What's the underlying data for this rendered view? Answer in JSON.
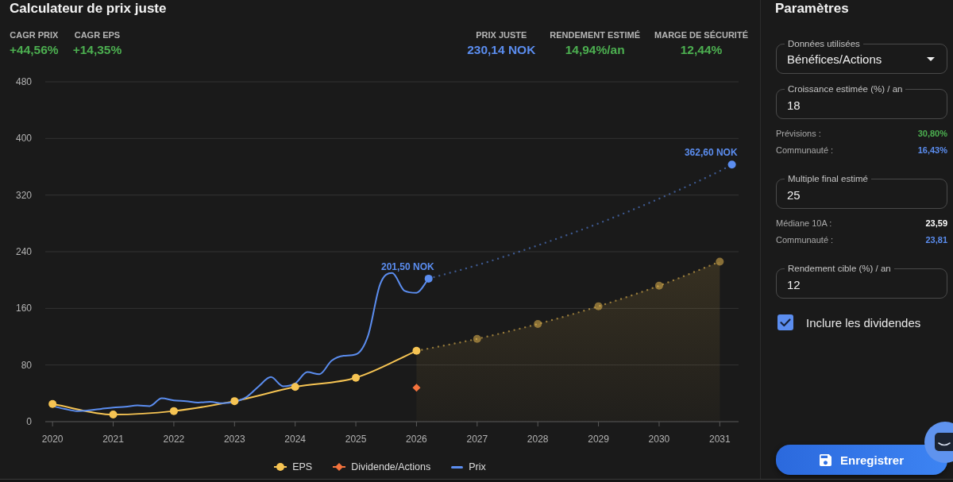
{
  "header": {
    "title": "Calculateur de prix juste"
  },
  "stats": {
    "left": [
      {
        "label": "CAGR PRIX",
        "value": "+44,56%",
        "color": "#4caf50"
      },
      {
        "label": "CAGR EPS",
        "value": "+14,35%",
        "color": "#4caf50"
      }
    ],
    "right": [
      {
        "label": "PRIX JUSTE",
        "value": "230,14 NOK",
        "color": "#5b8def"
      },
      {
        "label": "RENDEMENT ESTIMÉ",
        "value": "14,94%/an",
        "color": "#4caf50"
      },
      {
        "label": "MARGE DE SÉCURITÉ",
        "value": "12,44%",
        "color": "#4caf50"
      }
    ]
  },
  "chart": {
    "chart_data": {
      "type": "line",
      "grid": true,
      "x": [
        2020,
        2020.2,
        2020.4,
        2020.6,
        2020.8,
        2021,
        2021.2,
        2021.4,
        2021.6,
        2021.8,
        2022,
        2022.2,
        2022.4,
        2022.6,
        2022.8,
        2023,
        2023.2,
        2023.4,
        2023.6,
        2023.8,
        2024,
        2024.2,
        2024.4,
        2024.6,
        2024.8,
        2025,
        2025.2,
        2025.4,
        2025.6,
        2025.8,
        2026,
        2026.2,
        2027,
        2028,
        2029,
        2030,
        2031,
        2031.2
      ],
      "series": [
        {
          "name": "EPS",
          "color": "#f6c453",
          "marker": "circle",
          "values": [
            25,
            null,
            null,
            null,
            null,
            10,
            null,
            null,
            null,
            null,
            15,
            null,
            null,
            null,
            null,
            29,
            null,
            null,
            null,
            null,
            49,
            null,
            null,
            null,
            null,
            62,
            null,
            null,
            null,
            null,
            100,
            null,
            117,
            138,
            163,
            192,
            226,
            null
          ]
        },
        {
          "name": "Dividende/Actions",
          "color": "#f4733d",
          "marker": "diamond",
          "values": [
            null,
            null,
            null,
            null,
            null,
            null,
            null,
            null,
            null,
            null,
            null,
            null,
            null,
            null,
            null,
            null,
            null,
            null,
            null,
            null,
            null,
            null,
            null,
            null,
            null,
            null,
            null,
            null,
            null,
            null,
            48,
            null,
            null,
            null,
            null,
            null,
            null,
            null
          ]
        },
        {
          "name": "Prix",
          "color": "#5b8def",
          "values": [
            22,
            18,
            15,
            16,
            18,
            20,
            21,
            23,
            22,
            33,
            30,
            29,
            27,
            28,
            26,
            28,
            35,
            50,
            63,
            50,
            54,
            70,
            67,
            86,
            93,
            95,
            121,
            194,
            210,
            185,
            182,
            202,
            221,
            249,
            280,
            315,
            354,
            363
          ]
        }
      ],
      "xlim": [
        2019.88,
        2031.31
      ],
      "ylim": [
        0,
        480
      ],
      "xticks": [
        2020,
        2021,
        2022,
        2023,
        2024,
        2025,
        2026,
        2027,
        2028,
        2029,
        2030,
        2031
      ],
      "yticks": [
        0,
        80,
        160,
        240,
        320,
        400,
        480
      ],
      "annotations": [
        {
          "x": 2026.2,
          "y": 202,
          "text": "201,50 NOK"
        },
        {
          "x": 2031.2,
          "y": 363,
          "text": "362,60 NOK"
        }
      ]
    }
  },
  "sidebar": {
    "title": "Paramètres",
    "items": [
      {
        "kind": "select",
        "label": "Données utilisées",
        "value": "Bénéfices/Actions"
      },
      {
        "kind": "input",
        "label": "Croissance estimée (%) / an",
        "value": "18"
      },
      {
        "kind": "info",
        "label": "Prévisions :",
        "value": "30,80%",
        "color": "#4caf50"
      },
      {
        "kind": "info",
        "label": "Communauté :",
        "value": "16,43%",
        "color": "#5b8def"
      },
      {
        "kind": "input",
        "label": "Multiple final estimé",
        "value": "25"
      },
      {
        "kind": "info",
        "label": "Médiane 10A :",
        "value": "23,59",
        "color": "#ffffff"
      },
      {
        "kind": "info",
        "label": "Communauté :",
        "value": "23,81",
        "color": "#5b8def"
      },
      {
        "kind": "input",
        "label": "Rendement cible (%) / an",
        "value": "12"
      },
      {
        "kind": "checkbox",
        "label": "Inclure les dividendes",
        "checked": true
      }
    ],
    "save_button": {
      "label": "Enregistrer"
    }
  }
}
